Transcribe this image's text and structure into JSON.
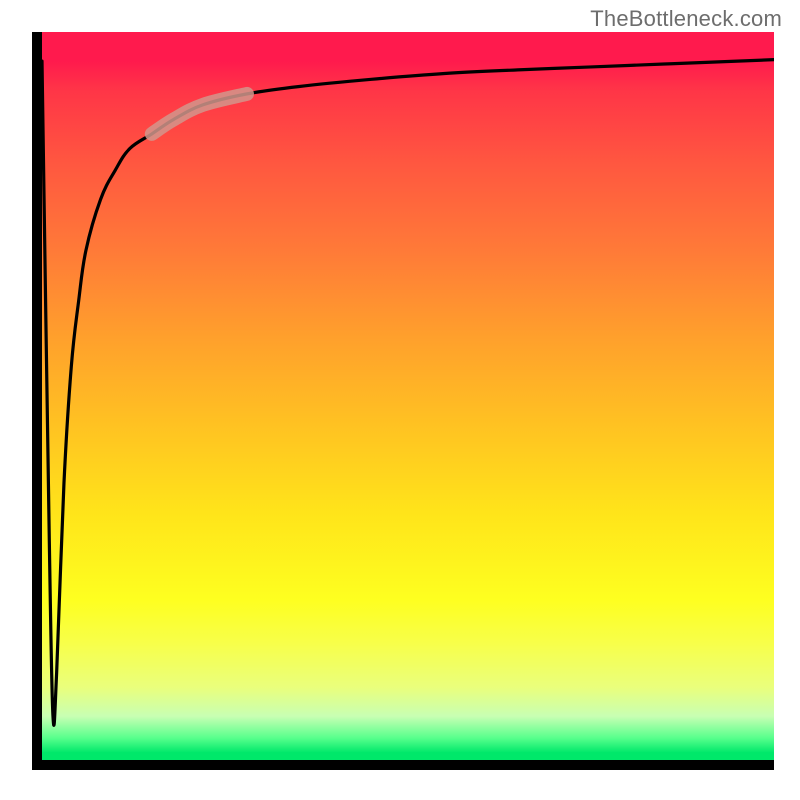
{
  "watermark": "TheBottleneck.com",
  "colors": {
    "axis": "#000000",
    "highlight": "rgba(210,150,140,0.85)",
    "gradient_top": "#ff1a4d",
    "gradient_mid": "#ffe41a",
    "gradient_bottom": "#00e86a"
  },
  "chart_data": {
    "type": "line",
    "title": "",
    "xlabel": "",
    "ylabel": "",
    "xlim": [
      0,
      100
    ],
    "ylim": [
      0,
      100
    ],
    "grid": false,
    "legend_position": "none",
    "series": [
      {
        "name": "bottleneck-curve",
        "x": [
          0,
          1,
          1.5,
          2,
          3,
          4,
          5,
          6,
          8,
          10,
          12,
          15,
          18,
          22,
          28,
          35,
          45,
          55,
          65,
          75,
          85,
          95,
          100
        ],
        "y": [
          96,
          30,
          6,
          12,
          38,
          54,
          63,
          70,
          77,
          81,
          84,
          86,
          88,
          90,
          91.5,
          92.5,
          93.5,
          94.3,
          94.8,
          95.2,
          95.6,
          96,
          96.2
        ]
      }
    ],
    "annotations": [
      {
        "name": "highlight-segment",
        "x_range": [
          18,
          28
        ],
        "note": "short thick pastel highlight along the curve"
      }
    ]
  }
}
